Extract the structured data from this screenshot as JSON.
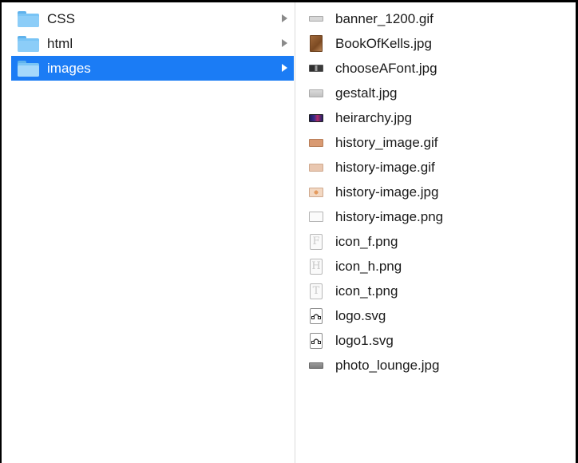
{
  "folders": [
    {
      "name": "CSS",
      "selected": false
    },
    {
      "name": "html",
      "selected": false
    },
    {
      "name": "images",
      "selected": true
    }
  ],
  "files": [
    {
      "name": "banner_1200.gif",
      "icon": "banner-thumbnail-icon"
    },
    {
      "name": "BookOfKells.jpg",
      "icon": "bookofkells-thumbnail-icon"
    },
    {
      "name": "chooseAFont.jpg",
      "icon": "chooseafont-thumbnail-icon"
    },
    {
      "name": "gestalt.jpg",
      "icon": "gestalt-thumbnail-icon"
    },
    {
      "name": "heirarchy.jpg",
      "icon": "heirarchy-thumbnail-icon"
    },
    {
      "name": "history_image.gif",
      "icon": "history-image-gif-thumbnail-icon"
    },
    {
      "name": "history-image.gif",
      "icon": "history-image-gif-thumbnail-icon"
    },
    {
      "name": "history-image.jpg",
      "icon": "history-image-jpg-thumbnail-icon"
    },
    {
      "name": "history-image.png",
      "icon": "history-image-png-thumbnail-icon"
    },
    {
      "name": "icon_f.png",
      "icon": "letter-f-thumbnail-icon",
      "glyph": "F"
    },
    {
      "name": "icon_h.png",
      "icon": "letter-h-thumbnail-icon",
      "glyph": "H"
    },
    {
      "name": "icon_t.png",
      "icon": "letter-t-thumbnail-icon",
      "glyph": "T"
    },
    {
      "name": "logo.svg",
      "icon": "svg-document-icon"
    },
    {
      "name": "logo1.svg",
      "icon": "svg-document-icon"
    },
    {
      "name": "photo_lounge.jpg",
      "icon": "photo-lounge-thumbnail-icon"
    }
  ],
  "colors": {
    "selection": "#1b7cf5",
    "folder": "#79c4f5"
  }
}
